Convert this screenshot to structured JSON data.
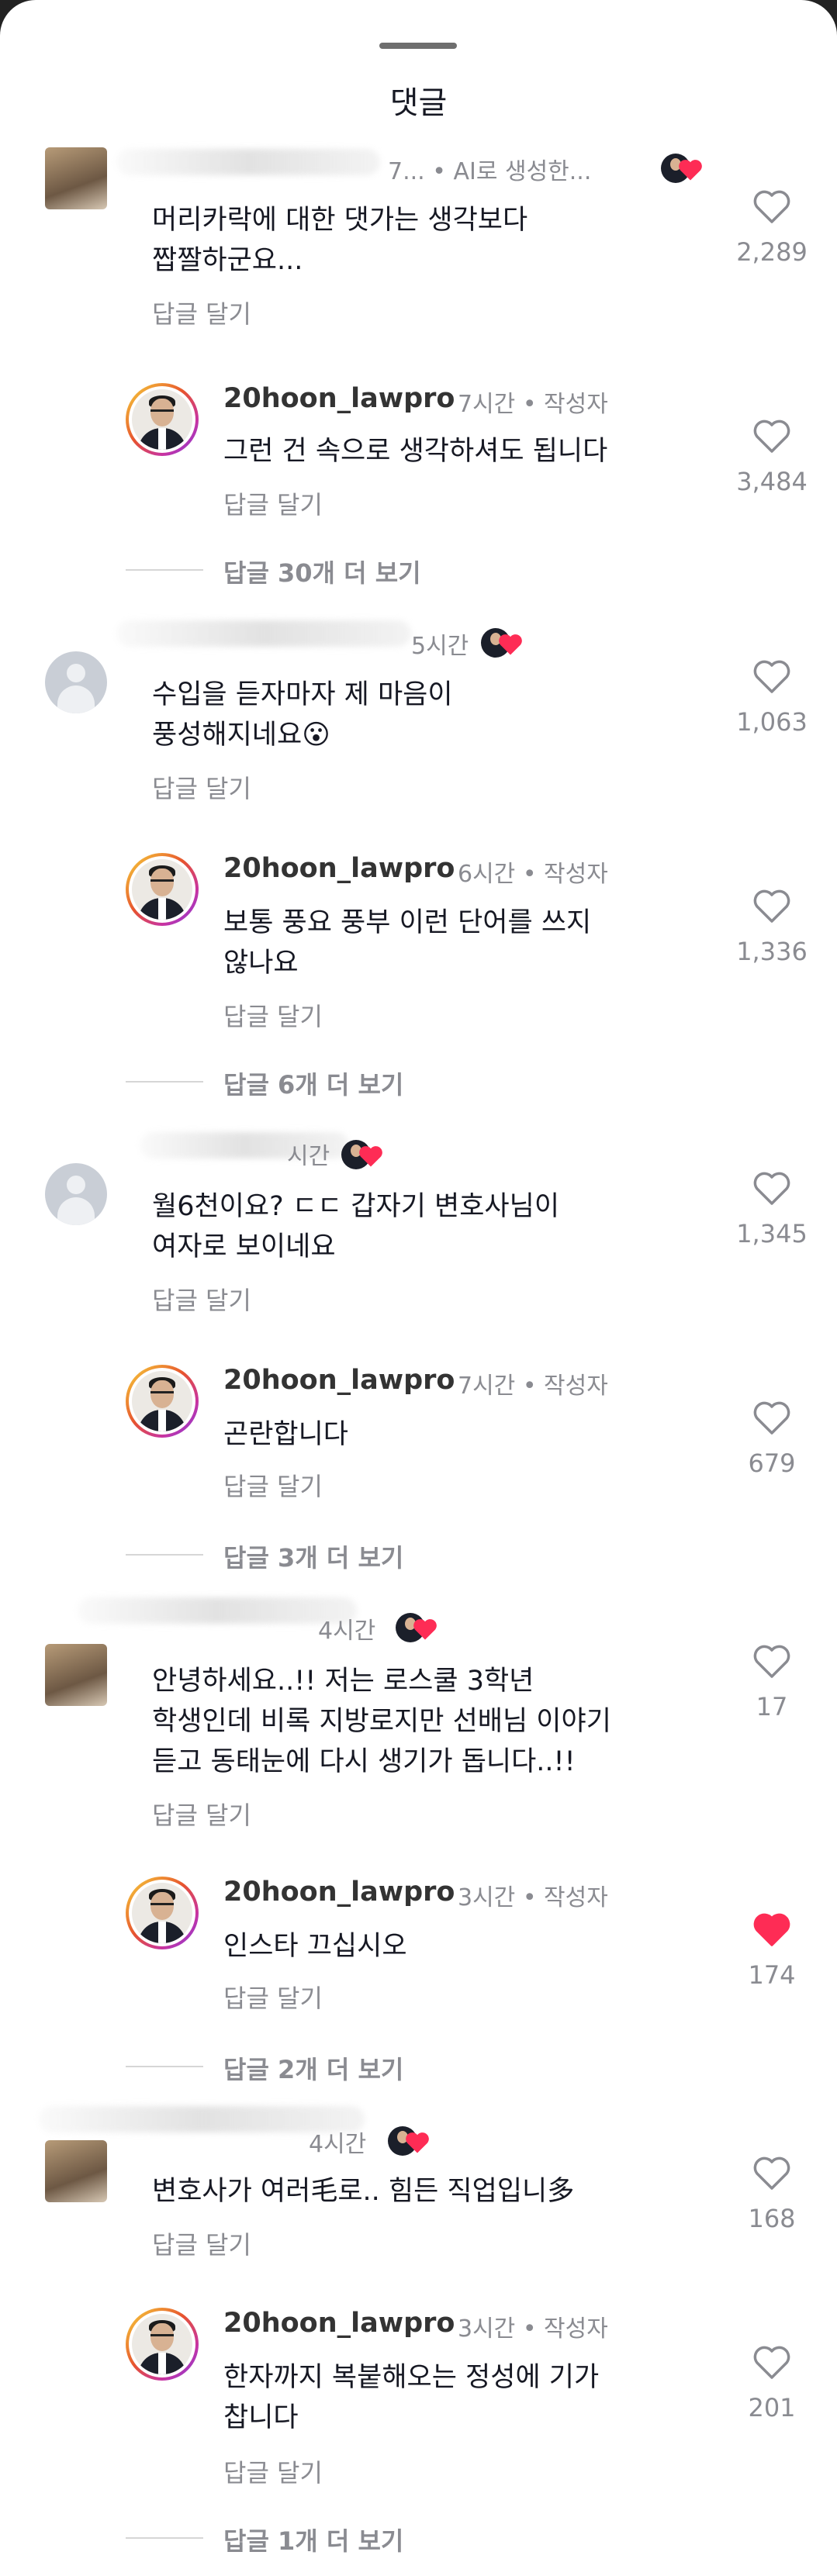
{
  "header": {
    "title": "댓글"
  },
  "icons": {
    "like": "heart-outline-icon",
    "liked": "heart-filled-icon",
    "creator_liked": "creator-liked-badge-icon"
  },
  "colors": {
    "liked": "#fe2c55",
    "secondary_text": "#8a8b91"
  },
  "reply_label": "답글 달기",
  "comments": [
    {
      "meta": "7... • AI로 생성한...",
      "text": "머리카락에 대한 댓가는 생각보다\n짭짤하군요...",
      "likes": "2,289",
      "liked": false,
      "author_reply": {
        "username": "20hoon_lawpro",
        "meta": "7시간 • 작성자",
        "text": "그런 건 속으로 생각하셔도 됩니다",
        "likes": "3,484",
        "liked": false
      },
      "more": "답글 30개 더 보기"
    },
    {
      "meta": "5시간",
      "text": "수입을 듣자마자 제 마음이\n풍성해지네요😮",
      "likes": "1,063",
      "liked": false,
      "author_reply": {
        "username": "20hoon_lawpro",
        "meta": "6시간 • 작성자",
        "text": "보통 풍요 풍부 이런 단어를 쓰지\n않나요",
        "likes": "1,336",
        "liked": false
      },
      "more": "답글 6개 더 보기"
    },
    {
      "meta": "시간",
      "text": "월6천이요? ㄷㄷ 갑자기 변호사님이\n여자로 보이네요",
      "likes": "1,345",
      "liked": false,
      "author_reply": {
        "username": "20hoon_lawpro",
        "meta": "7시간 • 작성자",
        "text": "곤란합니다",
        "likes": "679",
        "liked": false
      },
      "more": "답글 3개 더 보기"
    },
    {
      "meta": "4시간",
      "text": "안녕하세요..!! 저는 로스쿨 3학년\n학생인데 비록 지방로지만 선배님 이야기\n듣고 동태눈에 다시 생기가 돕니다..!!",
      "likes": "17",
      "liked": false,
      "author_reply": {
        "username": "20hoon_lawpro",
        "meta": "3시간 • 작성자",
        "text": "인스타 끄십시오",
        "likes": "174",
        "liked": true
      },
      "more": "답글 2개 더 보기"
    },
    {
      "meta": "4시간",
      "text": "변호사가 여러毛로.. 힘든 직업입니多",
      "likes": "168",
      "liked": false,
      "author_reply": {
        "username": "20hoon_lawpro",
        "meta": "3시간 • 작성자",
        "text": "한자까지 복붙해오는 정성에 기가\n찹니다",
        "likes": "201",
        "liked": false
      },
      "more": "답글 1개 더 보기"
    }
  ]
}
